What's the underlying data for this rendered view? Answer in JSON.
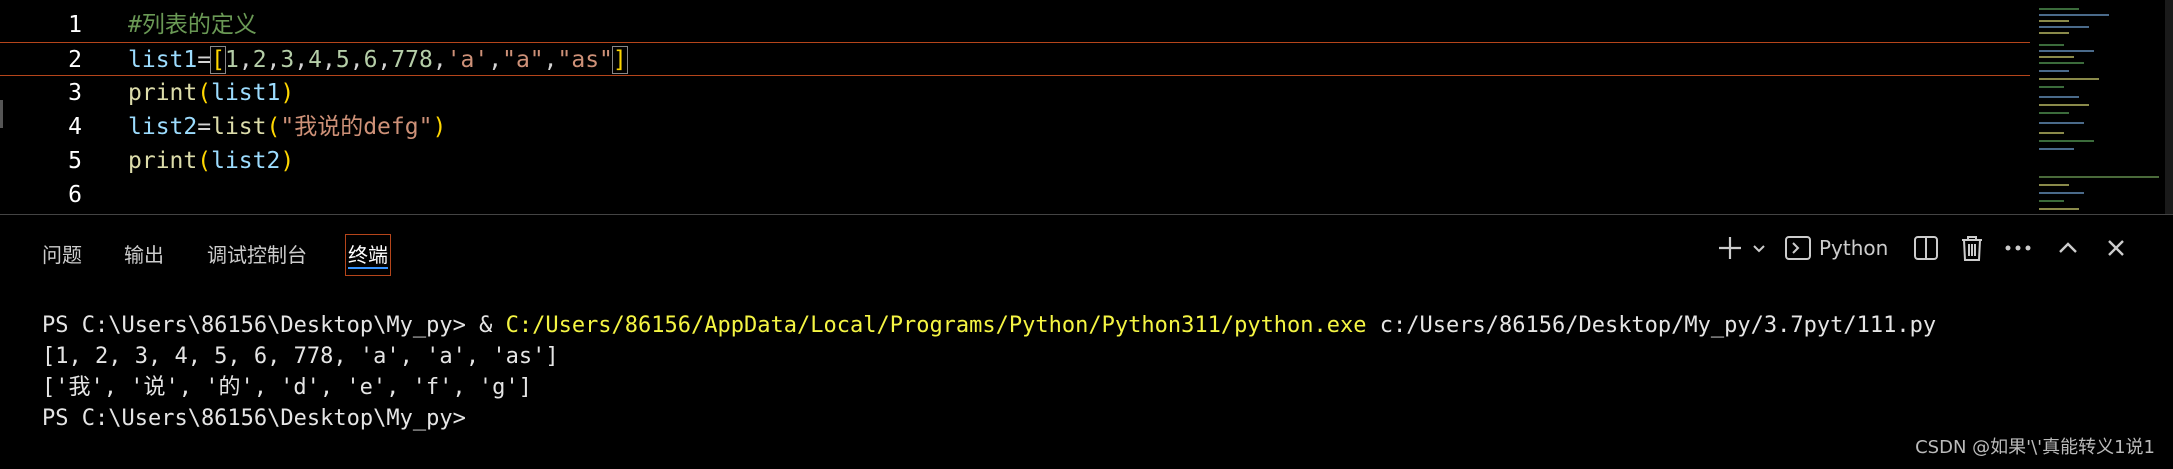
{
  "editor": {
    "lines": [
      {
        "num": "1",
        "tokens": [
          {
            "t": "#列表的定义",
            "c": "tk-comment"
          }
        ]
      },
      {
        "num": "2",
        "tokens": [
          {
            "t": "list1",
            "c": "tk-var"
          },
          {
            "t": "=",
            "c": "tk-op"
          },
          {
            "t": "[",
            "c": "tk-bracket"
          },
          {
            "t": "1",
            "c": "tk-num"
          },
          {
            "t": ",",
            "c": "tk-op"
          },
          {
            "t": "2",
            "c": "tk-num"
          },
          {
            "t": ",",
            "c": "tk-op"
          },
          {
            "t": "3",
            "c": "tk-num"
          },
          {
            "t": ",",
            "c": "tk-op"
          },
          {
            "t": "4",
            "c": "tk-num"
          },
          {
            "t": ",",
            "c": "tk-op"
          },
          {
            "t": "5",
            "c": "tk-num"
          },
          {
            "t": ",",
            "c": "tk-op"
          },
          {
            "t": "6",
            "c": "tk-num"
          },
          {
            "t": ",",
            "c": "tk-op"
          },
          {
            "t": "778",
            "c": "tk-num"
          },
          {
            "t": ",",
            "c": "tk-op"
          },
          {
            "t": "'a'",
            "c": "tk-str"
          },
          {
            "t": ",",
            "c": "tk-op"
          },
          {
            "t": "\"a\"",
            "c": "tk-str"
          },
          {
            "t": ",",
            "c": "tk-op"
          },
          {
            "t": "\"as\"",
            "c": "tk-str"
          },
          {
            "t": "]",
            "c": "tk-bracket"
          }
        ]
      },
      {
        "num": "3",
        "tokens": [
          {
            "t": "print",
            "c": "tk-func"
          },
          {
            "t": "(",
            "c": "tk-paren"
          },
          {
            "t": "list1",
            "c": "tk-var"
          },
          {
            "t": ")",
            "c": "tk-paren"
          }
        ]
      },
      {
        "num": "4",
        "tokens": [
          {
            "t": "list2",
            "c": "tk-var"
          },
          {
            "t": "=",
            "c": "tk-op"
          },
          {
            "t": "list",
            "c": "tk-func"
          },
          {
            "t": "(",
            "c": "tk-paren"
          },
          {
            "t": "\"我说的defg\"",
            "c": "tk-str"
          },
          {
            "t": ")",
            "c": "tk-paren"
          }
        ]
      },
      {
        "num": "5",
        "tokens": [
          {
            "t": "print",
            "c": "tk-func"
          },
          {
            "t": "(",
            "c": "tk-paren"
          },
          {
            "t": "list2",
            "c": "tk-var"
          },
          {
            "t": ")",
            "c": "tk-paren"
          }
        ]
      },
      {
        "num": "6",
        "tokens": []
      }
    ]
  },
  "panel": {
    "tabs": [
      {
        "label": "问题",
        "active": false
      },
      {
        "label": "输出",
        "active": false
      },
      {
        "label": "调试控制台",
        "active": false
      },
      {
        "label": "终端",
        "active": true
      }
    ],
    "shell_label": "Python",
    "icons": {
      "add": "plus-icon",
      "dropdown": "chevron-down-icon",
      "shell": "terminal-icon",
      "split": "split-icon",
      "trash": "trash-icon",
      "more": "more-icon",
      "maximize": "chevron-up-icon",
      "close": "close-icon"
    }
  },
  "terminal": {
    "lines": [
      [
        {
          "t": "PS C:\\Users\\86156\\Desktop\\My_py> & ",
          "c": ""
        },
        {
          "t": "C:/Users/86156/AppData/Local/Programs/Python/Python311/python.exe",
          "c": "tk-path"
        },
        {
          "t": " c:/Users/86156/Desktop/My_py/3.7pyt/111.py",
          "c": ""
        }
      ],
      [
        {
          "t": "[1, 2, 3, 4, 5, 6, 778, 'a', 'a', 'as']",
          "c": ""
        }
      ],
      [
        {
          "t": "['我', '说', '的', 'd', 'e', 'f', 'g']",
          "c": ""
        }
      ],
      [
        {
          "t": "PS C:\\Users\\86156\\Desktop\\My_py>",
          "c": ""
        }
      ]
    ]
  },
  "watermark": "CSDN @如果'\\'真能转义1说1"
}
